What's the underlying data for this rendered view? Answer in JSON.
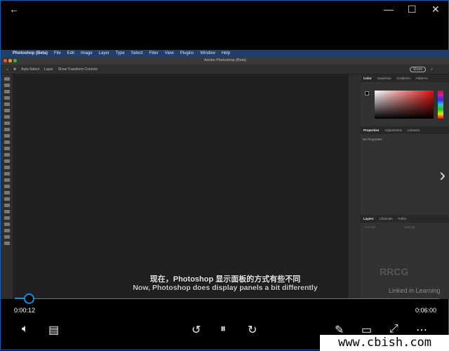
{
  "player": {
    "back_icon": "arrow-left-icon",
    "current_time": "0:00:12",
    "total_time": "0:06:00",
    "progress_percent": 3.3,
    "accent": "#1a8fd8"
  },
  "photoshop": {
    "menu": [
      "Photoshop (Beta)",
      "File",
      "Edit",
      "Image",
      "Layer",
      "Type",
      "Select",
      "Filter",
      "View",
      "Plugins",
      "Window",
      "Help"
    ],
    "window_title": "Adobe Photoshop (Beta)",
    "options": {
      "auto_select": "Auto-Select",
      "layer": "Layer",
      "show_transform": "Show Transform Controls",
      "share": "Share"
    },
    "color_tabs": [
      "Color",
      "Swatches",
      "Gradients",
      "Patterns"
    ],
    "properties_tabs": [
      "Properties",
      "Adjustments",
      "Libraries"
    ],
    "no_properties": "No Properties",
    "layers_tabs": [
      "Layers",
      "Channels",
      "Paths"
    ],
    "layers_kind": "Normal",
    "opacity": "Opacity"
  },
  "subtitles": {
    "zh": "现在，Photoshop 显示面板的方式有些不同",
    "en": "Now, Photoshop does display panels a bit differently"
  },
  "watermarks": {
    "logo": "RRCG",
    "linkedin": "Linked in Learning",
    "site": "www.cbish.com"
  }
}
